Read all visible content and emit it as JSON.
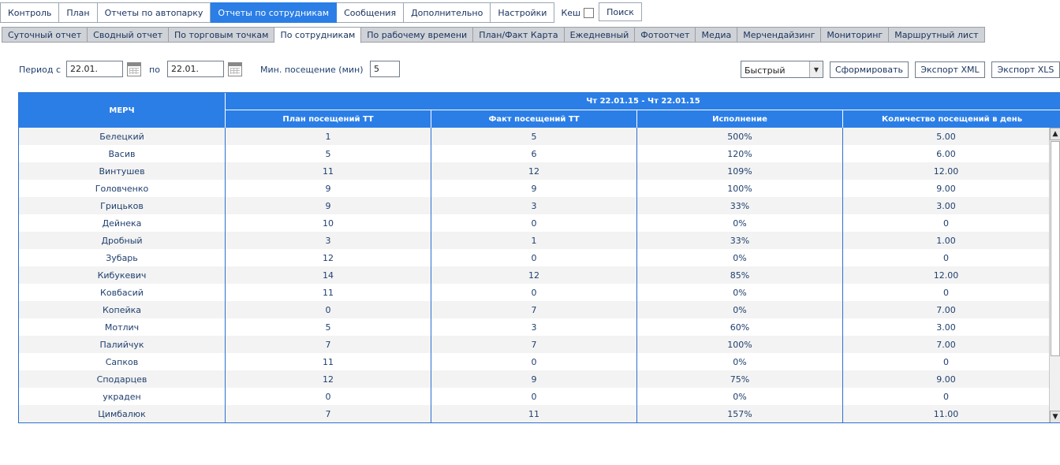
{
  "top_nav": {
    "items": [
      "Контроль",
      "План",
      "Отчеты по автопарку",
      "Отчеты по сотрудникам",
      "Сообщения",
      "Дополнительно",
      "Настройки"
    ],
    "active": "Отчеты по сотрудникам",
    "cache_label": "Кеш",
    "search_label": "Поиск"
  },
  "sub_tabs": {
    "items": [
      "Суточный отчет",
      "Сводный отчет",
      "По торговым точкам",
      "По сотрудникам",
      "По рабочему времени",
      "План/Факт Карта",
      "Ежедневный",
      "Фотоотчет",
      "Медиа",
      "Мерчендайзинг",
      "Мониторинг",
      "Маршрутный лист"
    ],
    "active": "По сотрудникам"
  },
  "filters": {
    "period_from_label": "Период с",
    "period_from_value": "22.01.",
    "period_to_label": "по",
    "period_to_value": "22.01.",
    "min_visit_label": "Мин. посещение (мин)",
    "min_visit_value": "5",
    "mode_value": "Быстрый",
    "build_button": "Сформировать",
    "export_xml_button": "Экспорт XML",
    "export_xls_button": "Экспорт XLS"
  },
  "table": {
    "merch_header": "МЕРЧ",
    "period_header": "Чт 22.01.15 - Чт 22.01.15",
    "columns": [
      "План посещений ТТ",
      "Факт посещений ТТ",
      "Исполнение",
      "Количество посещений в день"
    ],
    "rows": [
      [
        "Белецкий",
        "1",
        "5",
        "500%",
        "5.00"
      ],
      [
        "Васив",
        "5",
        "6",
        "120%",
        "6.00"
      ],
      [
        "Винтушев",
        "11",
        "12",
        "109%",
        "12.00"
      ],
      [
        "Головченко",
        "9",
        "9",
        "100%",
        "9.00"
      ],
      [
        "Грицьков",
        "9",
        "3",
        "33%",
        "3.00"
      ],
      [
        "Дейнека",
        "10",
        "0",
        "0%",
        "0"
      ],
      [
        "Дробный",
        "3",
        "1",
        "33%",
        "1.00"
      ],
      [
        "Зубарь",
        "12",
        "0",
        "0%",
        "0"
      ],
      [
        "Кибукевич",
        "14",
        "12",
        "85%",
        "12.00"
      ],
      [
        "Ковбасий",
        "11",
        "0",
        "0%",
        "0"
      ],
      [
        "Копейка",
        "0",
        "7",
        "0%",
        "7.00"
      ],
      [
        "Мотлич",
        "5",
        "3",
        "60%",
        "3.00"
      ],
      [
        "Палийчук",
        "7",
        "7",
        "100%",
        "7.00"
      ],
      [
        "Сапков",
        "11",
        "0",
        "0%",
        "0"
      ],
      [
        "Сподарцев",
        "12",
        "9",
        "75%",
        "9.00"
      ],
      [
        "украден",
        "0",
        "0",
        "0%",
        "0"
      ],
      [
        "Цимбалюк",
        "7",
        "11",
        "157%",
        "11.00"
      ]
    ]
  },
  "colors": {
    "accent": "#2b7ee6",
    "tab_bg": "#cfd2d6",
    "row_alt": "#f3f3f3"
  }
}
